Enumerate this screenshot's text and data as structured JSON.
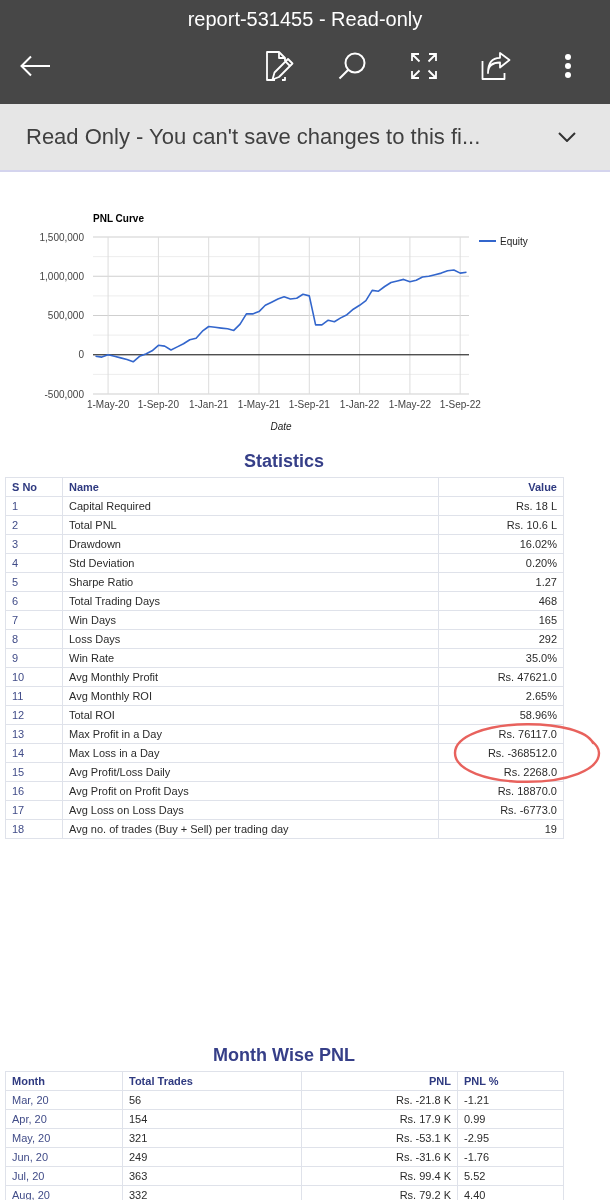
{
  "app_bar": {
    "title": "report-531455 - Read-only"
  },
  "notice": {
    "text": "Read Only - You can't save changes to this fi...",
    "expanded": false
  },
  "pnl_chart": {
    "chart_data": {
      "type": "line",
      "title": "PNL Curve",
      "xlabel": "Date",
      "grid": true,
      "categories": [
        null,
        null,
        "1-May-20",
        null,
        null,
        null,
        null,
        null,
        null,
        null,
        "1-Sep-20",
        null,
        null,
        null,
        null,
        null,
        null,
        null,
        "1-Jan-21",
        null,
        null,
        null,
        null,
        null,
        null,
        null,
        "1-May-21",
        null,
        null,
        null,
        null,
        null,
        null,
        null,
        "1-Sep-21",
        null,
        null,
        null,
        null,
        null,
        null,
        null,
        "1-Jan-22",
        null,
        null,
        null,
        null,
        null,
        null,
        null,
        "1-May-22",
        null,
        null,
        null,
        null,
        null,
        null,
        null,
        "1-Sep-22",
        null
      ],
      "series": [
        {
          "name": "Equity",
          "color": "#3366cc",
          "values": [
            -20000,
            -30000,
            0,
            -20000,
            -40000,
            -60000,
            -90000,
            -20000,
            10000,
            50000,
            120000,
            110000,
            60000,
            100000,
            140000,
            190000,
            210000,
            300000,
            360000,
            350000,
            340000,
            330000,
            310000,
            390000,
            520000,
            520000,
            550000,
            630000,
            670000,
            710000,
            740000,
            710000,
            720000,
            770000,
            750000,
            380000,
            380000,
            440000,
            420000,
            470000,
            510000,
            580000,
            630000,
            690000,
            820000,
            810000,
            870000,
            920000,
            940000,
            960000,
            930000,
            950000,
            990000,
            1000000,
            1020000,
            1040000,
            1070000,
            1080000,
            1040000,
            1050000
          ]
        }
      ],
      "ylim": [
        -500000,
        1500000
      ],
      "yticks": [
        {
          "value": -500000,
          "label": "-500,000"
        },
        {
          "value": 0,
          "label": "0"
        },
        {
          "value": 500000,
          "label": "500,000"
        },
        {
          "value": 1000000,
          "label": "1,000,000"
        },
        {
          "value": 1500000,
          "label": "1,500,000"
        }
      ]
    }
  },
  "statistics": {
    "title": "Statistics",
    "columns": [
      "S No",
      "Name",
      "Value"
    ],
    "rows": [
      [
        "1",
        "Capital Required",
        "Rs. 18 L"
      ],
      [
        "2",
        "Total PNL",
        "Rs. 10.6 L"
      ],
      [
        "3",
        "Drawdown",
        "16.02%"
      ],
      [
        "4",
        "Std Deviation",
        "0.20%"
      ],
      [
        "5",
        "Sharpe Ratio",
        "1.27"
      ],
      [
        "6",
        "Total Trading Days",
        "468"
      ],
      [
        "7",
        "Win Days",
        "165"
      ],
      [
        "8",
        "Loss Days",
        "292"
      ],
      [
        "9",
        "Win Rate",
        "35.0%"
      ],
      [
        "10",
        "Avg Monthly Profit",
        "Rs. 47621.0"
      ],
      [
        "11",
        "Avg Monthly ROI",
        "2.65%"
      ],
      [
        "12",
        "Total ROI",
        "58.96%"
      ],
      [
        "13",
        "Max Profit in a Day",
        "Rs. 76117.0"
      ],
      [
        "14",
        "Max Loss in a Day",
        "Rs. -368512.0"
      ],
      [
        "15",
        "Avg Profit/Loss Daily",
        "Rs. 2268.0"
      ],
      [
        "16",
        "Avg Profit on Profit Days",
        "Rs. 18870.0"
      ],
      [
        "17",
        "Avg Loss on Loss Days",
        "Rs. -6773.0"
      ],
      [
        "18",
        "Avg no. of trades (Buy + Sell) per trading day",
        "19"
      ]
    ],
    "annotations": [
      {
        "kind": "freehand-circle"
      }
    ]
  },
  "month_wise_pnl": {
    "title": "Month Wise PNL",
    "columns": [
      "Month",
      "Total Trades",
      "PNL",
      "PNL %"
    ],
    "rows": [
      [
        "Mar, 20",
        "56",
        "Rs. -21.8 K",
        "-1.21"
      ],
      [
        "Apr, 20",
        "154",
        "Rs. 17.9 K",
        "0.99"
      ],
      [
        "May, 20",
        "321",
        "Rs. -53.1 K",
        "-2.95"
      ],
      [
        "Jun, 20",
        "249",
        "Rs. -31.6 K",
        "-1.76"
      ],
      [
        "Jul, 20",
        "363",
        "Rs. 99.4 K",
        "5.52"
      ],
      [
        "Aug, 20",
        "332",
        "Rs. 79.2 K",
        "4.40"
      ]
    ]
  }
}
